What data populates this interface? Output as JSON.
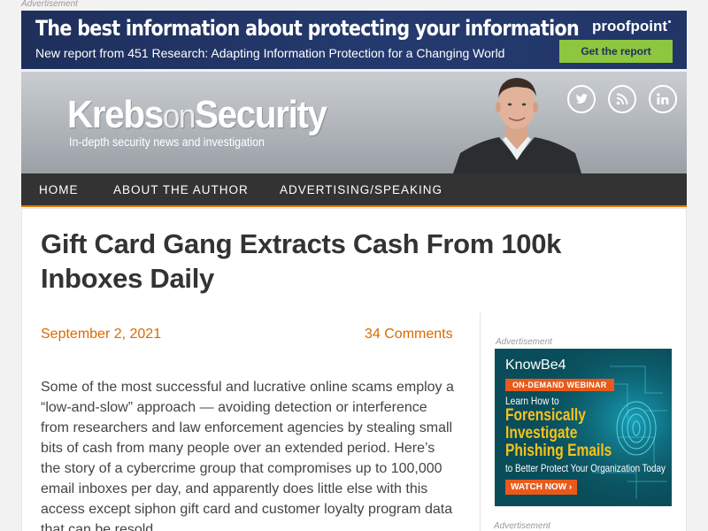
{
  "top_ad": {
    "label": "Advertisement",
    "headline": "The best information about protecting your information",
    "subline": "New report from 451 Research: Adapting Information Protection for a Changing World",
    "brand": "proofpoint",
    "cta": "Get the report"
  },
  "header": {
    "logo_part1": "Krebs",
    "logo_part2": "on",
    "logo_part3": "Security",
    "tagline": "In-depth security news and investigation",
    "social_icons": [
      "twitter-icon",
      "rss-icon",
      "linkedin-icon"
    ]
  },
  "nav": {
    "items": [
      {
        "label": "HOME"
      },
      {
        "label": "ABOUT THE AUTHOR"
      },
      {
        "label": "ADVERTISING/SPEAKING"
      }
    ]
  },
  "post": {
    "title": "Gift Card Gang Extracts Cash From 100k Inboxes Daily",
    "date": "September 2, 2021",
    "comments": "34 Comments",
    "body": "Some of the most successful and lucrative online scams employ a “low-and-slow” approach — avoiding detection or interference from researchers and law enforcement agencies by stealing small bits of cash from many people over an extended period. Here’s the story of a cybercrime group that compromises up to 100,000 email inboxes per day, and apparently does little else with this access except siphon gift card and customer loyalty program data that can be resold"
  },
  "sidebar_ad": {
    "label": "Advertisement",
    "brand": "KnowBe4",
    "badge": "ON-DEMAND WEBINAR",
    "lead": "Learn How to",
    "big_line1": "Forensically",
    "big_line2": "Investigate",
    "big_line3": "Phishing Emails",
    "small": "to Better Protect Your Organization Today",
    "cta": "WATCH NOW ›",
    "label2": "Advertisement"
  },
  "colors": {
    "accent_orange": "#d96a00",
    "nav_bg": "#333333",
    "ad_navy": "#1f2f5c",
    "ad_green": "#8dc63f"
  }
}
